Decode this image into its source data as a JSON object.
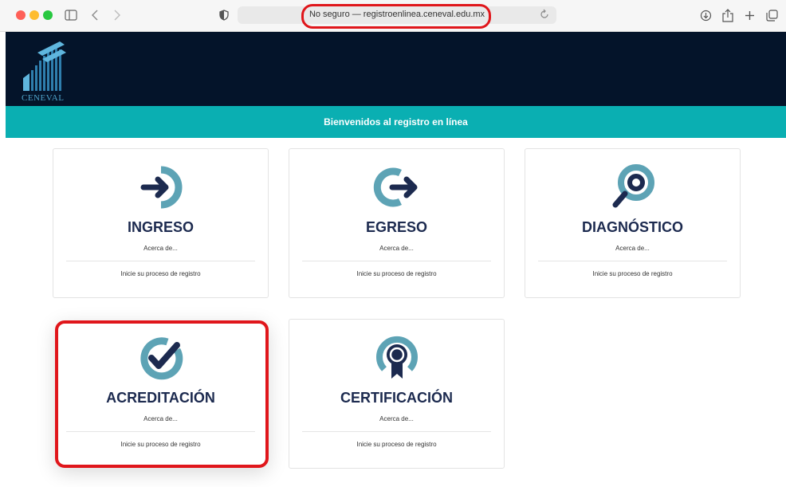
{
  "browser": {
    "address_text": "No seguro — registroenlinea.ceneval.edu.mx",
    "icons": [
      "sidebar-icon",
      "back-icon",
      "forward-icon",
      "shield-icon",
      "reload-icon",
      "download-icon",
      "share-icon",
      "new-tab-icon",
      "tabs-overview-icon"
    ]
  },
  "site": {
    "logo_text": "CENEVAL",
    "welcome": "Bienvenidos al registro en línea"
  },
  "cards": [
    {
      "title": "INGRESO",
      "about": "Acerca de...",
      "register": "Inicie su proceso de registro",
      "icon": "arrow-in-icon"
    },
    {
      "title": "EGRESO",
      "about": "Acerca de...",
      "register": "Inicie su proceso de registro",
      "icon": "arrow-out-icon"
    },
    {
      "title": "DIAGNÓSTICO",
      "about": "Acerca de...",
      "register": "Inicie su proceso de registro",
      "icon": "magnifier-icon"
    },
    {
      "title": "ACREDITACIÓN",
      "about": "Acerca de...",
      "register": "Inicie su proceso de registro",
      "icon": "check-icon"
    },
    {
      "title": "CERTIFICACIÓN",
      "about": "Acerca de...",
      "register": "Inicie su proceso de registro",
      "icon": "award-icon"
    }
  ],
  "colors": {
    "header_bg": "#04142a",
    "welcome_bg": "#0aafb2",
    "icon_teal": "#5da3b5",
    "icon_navy": "#1c2a4f",
    "highlight_red": "#e0161b"
  }
}
